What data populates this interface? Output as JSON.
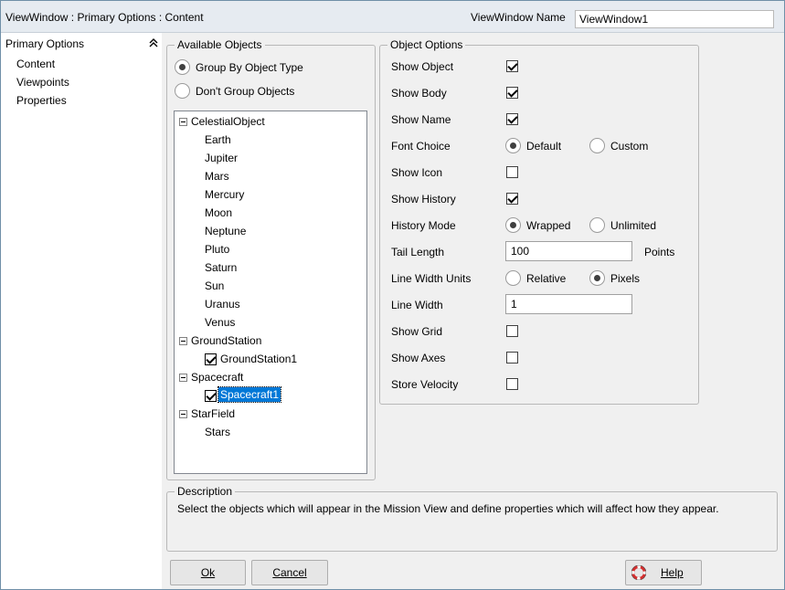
{
  "title": "ViewWindow : Primary Options : Content",
  "viewwindow_name_label": "ViewWindow Name",
  "viewwindow_name_value": "ViewWindow1",
  "nav": {
    "header": "Primary Options",
    "items": [
      "Content",
      "Viewpoints",
      "Properties"
    ]
  },
  "available": {
    "title": "Available Objects",
    "radio_group": "Group By Object Type",
    "radio_nogroup": "Don't Group Objects",
    "selected_radio": "Group By Object Type",
    "tree": {
      "celestial": "CelestialObject",
      "celestial_items": [
        "Earth",
        "Jupiter",
        "Mars",
        "Mercury",
        "Moon",
        "Neptune",
        "Pluto",
        "Saturn",
        "Sun",
        "Uranus",
        "Venus"
      ],
      "ground": "GroundStation",
      "ground_item": "GroundStation1",
      "spacecraft": "Spacecraft",
      "spacecraft_item": "Spacecraft1",
      "starfield": "StarField",
      "starfield_item": "Stars"
    }
  },
  "options": {
    "title": "Object Options",
    "show_object": "Show Object",
    "show_body": "Show Body",
    "show_name": "Show Name",
    "font_choice": "Font Choice",
    "font_default": "Default",
    "font_custom": "Custom",
    "show_icon": "Show Icon",
    "show_history": "Show History",
    "history_mode": "History Mode",
    "history_wrapped": "Wrapped",
    "history_unlimited": "Unlimited",
    "tail_length": "Tail Length",
    "tail_length_value": "100",
    "tail_units": "Points",
    "line_width_units": "Line Width Units",
    "lwu_relative": "Relative",
    "lwu_pixels": "Pixels",
    "line_width": "Line Width",
    "line_width_value": "1",
    "show_grid": "Show Grid",
    "show_axes": "Show Axes",
    "store_velocity": "Store Velocity"
  },
  "description": {
    "title": "Description",
    "text": "Select the objects which will appear in the Mission View and define properties which will affect how they appear."
  },
  "buttons": {
    "ok": "Ok",
    "cancel": "Cancel",
    "help": "Help"
  },
  "colors": {
    "selection": "#0078d7",
    "titlebar": "#e6ebf1",
    "help_icon": "#d32f2f"
  }
}
